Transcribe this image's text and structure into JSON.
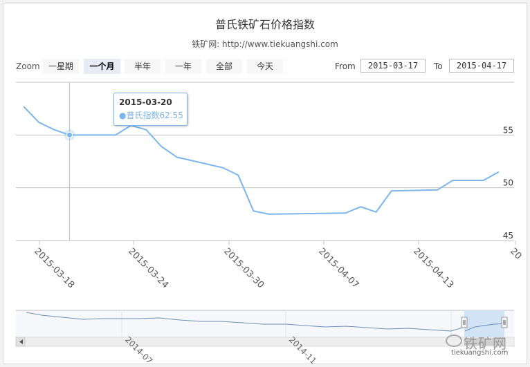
{
  "header": {
    "title": "普氏铁矿石价格指数",
    "subtitle": "铁矿网: http://www.tiekuangshi.com"
  },
  "range_selector": {
    "zoom_label": "Zoom",
    "buttons": [
      "一星期",
      "一个月",
      "半年",
      "一年",
      "全部",
      "今天"
    ],
    "active_button": "一个月",
    "from_label": "From",
    "from_value": "2015-03-17",
    "to_label": "To",
    "to_value": "2015-04-17"
  },
  "tooltip": {
    "date": "2015-03-20",
    "series_text": "●普氏指数62.55"
  },
  "watermark": {
    "text": "铁矿网",
    "url": "tiekuangshi.com"
  },
  "colors": {
    "series": "#7cb5ec",
    "grid": "#c0c0c0",
    "navigator_mask": "#cfe0f5",
    "background": "#ffffff"
  },
  "chart_data": {
    "type": "line",
    "series": [
      {
        "name": "普氏指数",
        "x": [
          "2015-03-17",
          "2015-03-18",
          "2015-03-19",
          "2015-03-20",
          "2015-03-23",
          "2015-03-24",
          "2015-03-25",
          "2015-03-26",
          "2015-03-27",
          "2015-03-30",
          "2015-03-31",
          "2015-04-01",
          "2015-04-02",
          "2015-04-07",
          "2015-04-08",
          "2015-04-09",
          "2015-04-10",
          "2015-04-13",
          "2015-04-14",
          "2015-04-15",
          "2015-04-16",
          "2015-04-17"
        ],
        "values": [
          57.7,
          56.2,
          55.5,
          55.0,
          55.0,
          55.9,
          55.5,
          53.9,
          52.9,
          51.9,
          51.2,
          47.8,
          47.5,
          47.6,
          48.2,
          47.7,
          49.7,
          49.8,
          50.7,
          50.7,
          50.7,
          51.5
        ]
      }
    ],
    "xticks": [
      "2015-03-18",
      "2015-03-24",
      "2015-03-30",
      "2015-04-07",
      "2015-04-13",
      "20"
    ],
    "ytick_labels": [
      "55",
      "50",
      "45"
    ],
    "ylim": [
      45,
      60
    ],
    "grid": true,
    "highlight_date": "2015-03-20",
    "navigator": {
      "tick_labels": [
        "2014-07",
        "2014-11"
      ]
    }
  }
}
